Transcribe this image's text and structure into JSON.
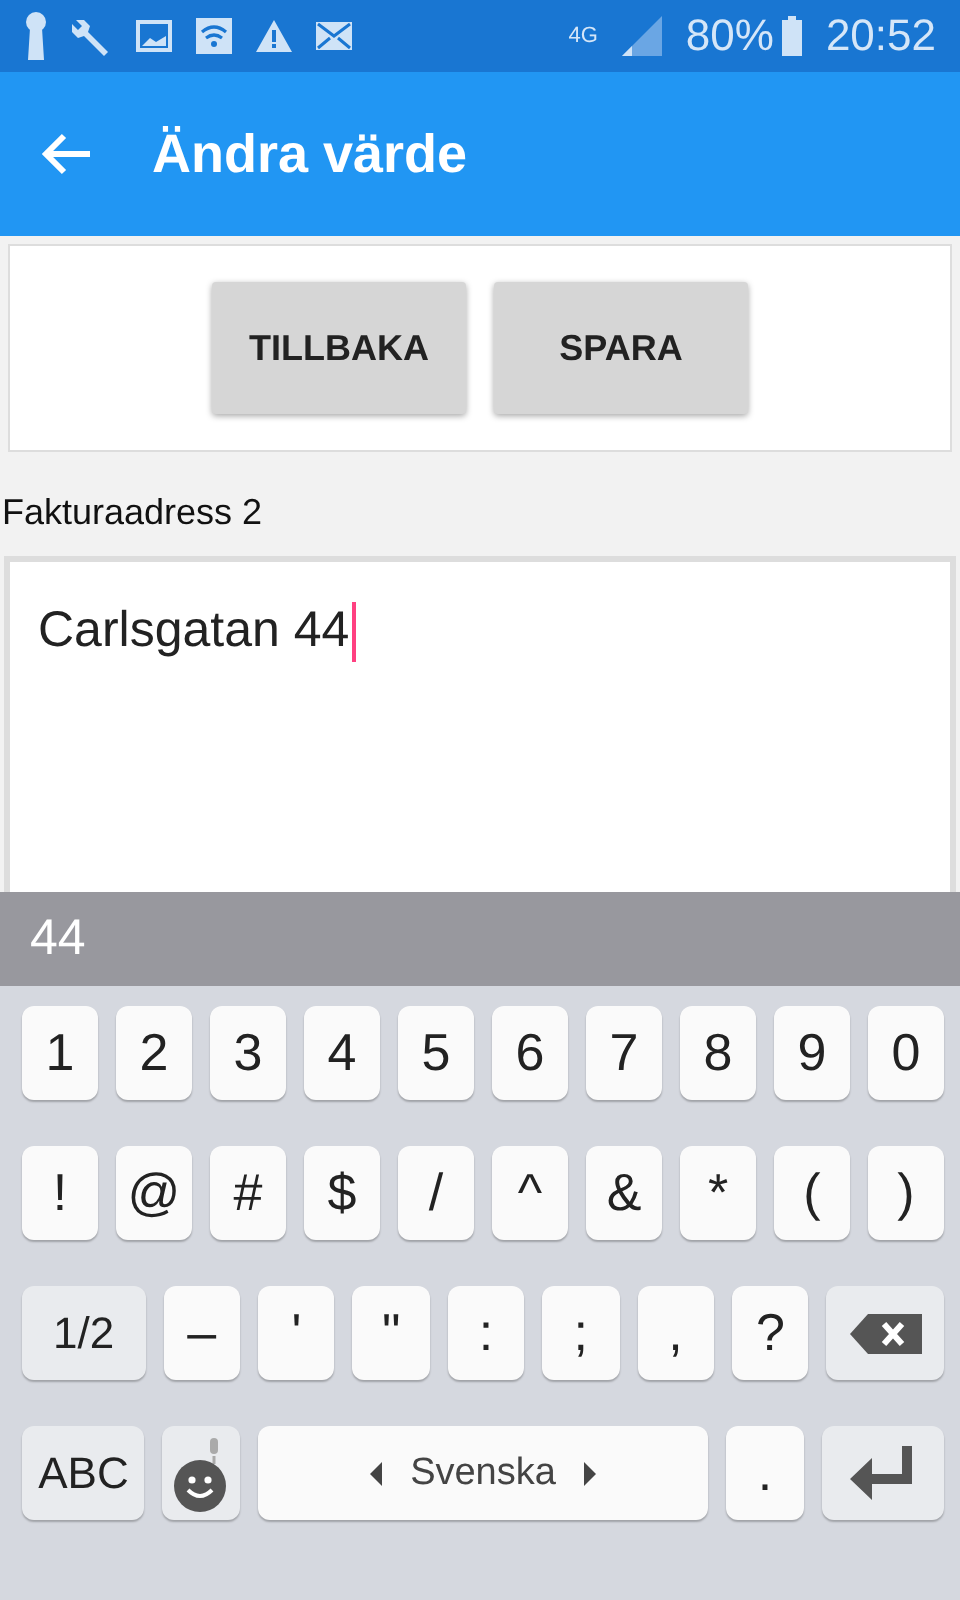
{
  "status_bar": {
    "network": "4G",
    "battery": "80%",
    "time": "20:52"
  },
  "app_bar": {
    "title": "Ändra värde"
  },
  "actions": [
    "TILLBAKA",
    "SPARA"
  ],
  "field": {
    "label": "Fakturaadress 2",
    "value": "Carlsgatan 44"
  },
  "suggestion": "44",
  "keyboard": [
    [
      {
        "kind": "char",
        "label": "1"
      },
      {
        "kind": "char",
        "label": "2"
      },
      {
        "kind": "char",
        "label": "3"
      },
      {
        "kind": "char",
        "label": "4"
      },
      {
        "kind": "char",
        "label": "5"
      },
      {
        "kind": "char",
        "label": "6"
      },
      {
        "kind": "char",
        "label": "7"
      },
      {
        "kind": "char",
        "label": "8"
      },
      {
        "kind": "char",
        "label": "9"
      },
      {
        "kind": "char",
        "label": "0"
      }
    ],
    [
      {
        "kind": "char",
        "label": "!"
      },
      {
        "kind": "char",
        "label": "@"
      },
      {
        "kind": "char",
        "label": "#"
      },
      {
        "kind": "char",
        "label": "$"
      },
      {
        "kind": "char",
        "label": "/"
      },
      {
        "kind": "char",
        "label": "^"
      },
      {
        "kind": "char",
        "label": "&"
      },
      {
        "kind": "char",
        "label": "*"
      },
      {
        "kind": "char",
        "label": "("
      },
      {
        "kind": "char",
        "label": ")"
      }
    ],
    [
      {
        "kind": "function",
        "label": "1/2"
      },
      {
        "kind": "char",
        "label": "–"
      },
      {
        "kind": "char",
        "label": "'"
      },
      {
        "kind": "char",
        "label": "\""
      },
      {
        "kind": "char",
        "label": ":"
      },
      {
        "kind": "char",
        "label": ";"
      },
      {
        "kind": "char",
        "label": ","
      },
      {
        "kind": "char",
        "label": "?"
      },
      {
        "kind": "backspace"
      }
    ],
    [
      {
        "kind": "function",
        "label": "ABC"
      },
      {
        "kind": "emoji"
      },
      {
        "kind": "space",
        "label": "Svenska"
      },
      {
        "kind": "char",
        "label": "."
      },
      {
        "kind": "enter"
      }
    ]
  ]
}
